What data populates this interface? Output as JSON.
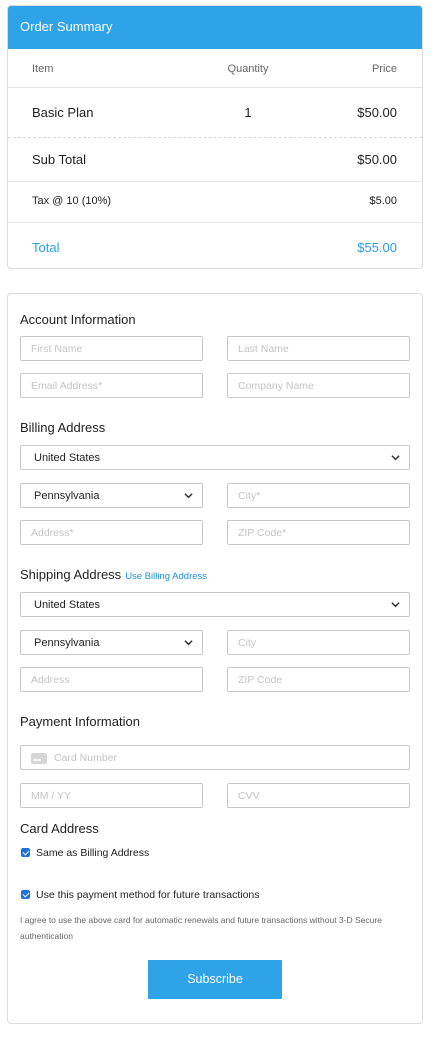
{
  "summary": {
    "title": "Order Summary",
    "columns": {
      "item": "Item",
      "quantity": "Quantity",
      "price": "Price"
    },
    "line_item": {
      "name": "Basic Plan",
      "quantity": "1",
      "price": "$50.00"
    },
    "subtotal": {
      "label": "Sub Total",
      "value": "$50.00"
    },
    "tax": {
      "label": "Tax @ 10 (10%)",
      "value": "$5.00"
    },
    "total": {
      "label": "Total",
      "value": "$55.00"
    },
    "accent_color": "#2ea3e8"
  },
  "account": {
    "title": "Account Information",
    "first_name_placeholder": "First Name",
    "last_name_placeholder": "Last Name",
    "email_placeholder": "Email Address*",
    "company_placeholder": "Company Name"
  },
  "billing": {
    "title": "Billing Address",
    "country": "United States",
    "state": "Pennsylvania",
    "city_placeholder": "City*",
    "address_placeholder": "Address*",
    "zip_placeholder": "ZIP Code*"
  },
  "shipping": {
    "title": "Shipping Address",
    "use_billing_link": "Use Billing Address",
    "country": "United States",
    "state": "Pennsylvania",
    "city_placeholder": "City",
    "address_placeholder": "Address",
    "zip_placeholder": "ZIP Code"
  },
  "payment": {
    "title": "Payment Information",
    "card_number_placeholder": "Card Number",
    "expiry_placeholder": "MM / YY",
    "cvv_placeholder": "CVV",
    "card_icon": "credit-card-icon"
  },
  "card_address": {
    "title": "Card Address",
    "same_as_billing_label": "Same as Billing Address",
    "same_as_billing_checked": true
  },
  "future": {
    "label": "Use this payment method for future transactions",
    "checked": true,
    "agreement": "I agree to use the above card for automatic renewals and future transactions without 3-D Secure authentication"
  },
  "subscribe_label": "Subscribe"
}
